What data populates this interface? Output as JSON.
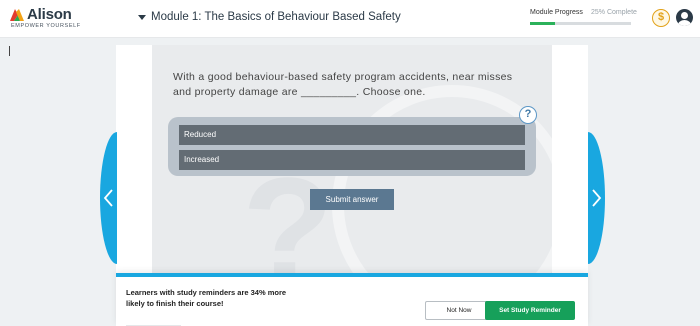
{
  "brand": {
    "name": "Alison",
    "tagline": "EMPOWER YOURSELF",
    "colors": {
      "accent": "#19a7e0",
      "success": "#16a05a",
      "logo_red": "#e23b2e",
      "logo_green": "#28a84f",
      "logo_orange": "#f2a316"
    }
  },
  "header": {
    "module_title": "Module 1: The Basics of Behaviour Based Safety",
    "progress": {
      "label": "Module Progress",
      "complete_text": "25% Complete",
      "fraction": 0.25
    },
    "icons": {
      "coin": "dollar-coin-icon",
      "avatar": "user-avatar-icon",
      "toggle": "caret-down-icon"
    },
    "coin_symbol": "$"
  },
  "quiz": {
    "question": "With a good behaviour-based safety program accidents, near misses and property damage are _________. Choose one.",
    "help_symbol": "?",
    "options": [
      {
        "label": "Reduced"
      },
      {
        "label": "Increased"
      }
    ],
    "submit_label": "Submit answer"
  },
  "navigation": {
    "prev_icon": "chevron-left-icon",
    "next_icon": "chevron-right-icon"
  },
  "reminder": {
    "message": "Learners with study reminders are 34% more likely to finish their course!",
    "not_now_label": "Not Now",
    "set_label": "Set Study Reminder"
  }
}
